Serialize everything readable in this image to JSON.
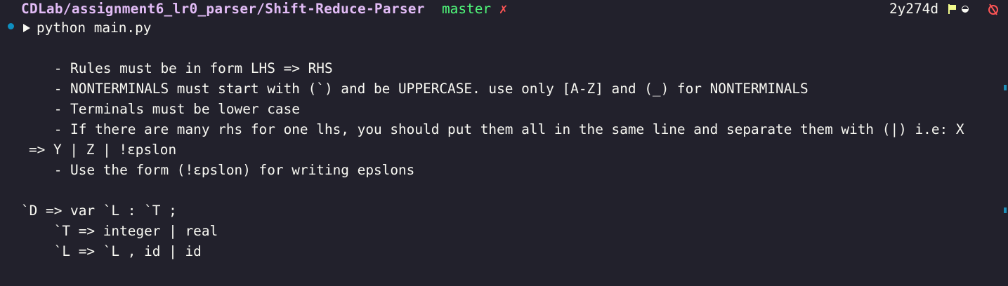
{
  "prompt": {
    "path": "CDLab/assignment6_lr0_parser/Shift-Reduce-Parser",
    "branch": "master",
    "dirty_mark": "✗",
    "commit": "2y274d",
    "command": "python main.py"
  },
  "output": {
    "lines": [
      "    - Rules must be in form LHS => RHS",
      "    - NONTERMINALS must start with (`) and be UPPERCASE. use only [A-Z] and (_) for NONTERMINALS",
      "    - Terminals must be lower case",
      "    - If there are many rhs for one lhs, you should put them all in the same line and separate them with (|) i.e: X",
      "=> Y | Z | !εpslon",
      "    - Use the form (!εpslon) for writing epslons",
      "",
      "`D => var `L : `T ;",
      "    `T => integer | real",
      "    `L => `L , id | id"
    ]
  },
  "colors": {
    "background": "#22212c",
    "path": "#e2bcf6",
    "branch": "#50fa7b",
    "dirty": "#ff5555",
    "status_dot": "#0e8fc0"
  },
  "icons": {
    "status": "flag-icon",
    "half": "halfmoon-icon",
    "sync": "no-sync-icon"
  }
}
